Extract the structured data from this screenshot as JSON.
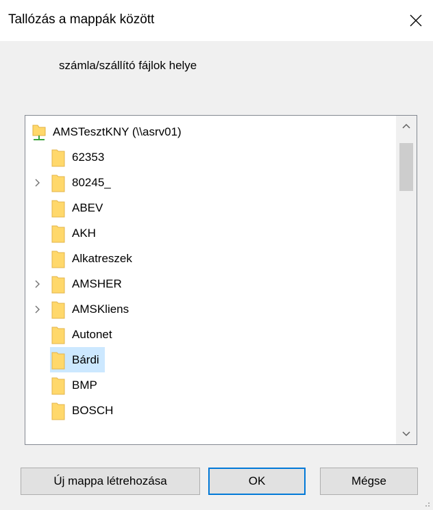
{
  "window": {
    "title": "Tallózás a mappák között",
    "prompt": "számla/szállító fájlok helye"
  },
  "tree": {
    "root": {
      "label": "AMSTesztKNY (\\\\asrv01)",
      "icon": "network-drive-icon"
    },
    "items": [
      {
        "label": "62353",
        "expandable": false,
        "selected": false
      },
      {
        "label": "80245_",
        "expandable": true,
        "selected": false
      },
      {
        "label": "ABEV",
        "expandable": false,
        "selected": false
      },
      {
        "label": "AKH",
        "expandable": false,
        "selected": false
      },
      {
        "label": "Alkatreszek",
        "expandable": false,
        "selected": false
      },
      {
        "label": "AMSHER",
        "expandable": true,
        "selected": false
      },
      {
        "label": "AMSKliens",
        "expandable": true,
        "selected": false
      },
      {
        "label": "Autonet",
        "expandable": false,
        "selected": false
      },
      {
        "label": "Bárdi",
        "expandable": false,
        "selected": true
      },
      {
        "label": "BMP",
        "expandable": false,
        "selected": false
      },
      {
        "label": "BOSCH",
        "expandable": false,
        "selected": false
      }
    ]
  },
  "buttons": {
    "new_folder": "Új mappa létrehozása",
    "ok": "OK",
    "cancel": "Mégse"
  },
  "colors": {
    "selection": "#cce8ff",
    "folder": "#ffd86b",
    "default_button_border": "#0078d7"
  }
}
